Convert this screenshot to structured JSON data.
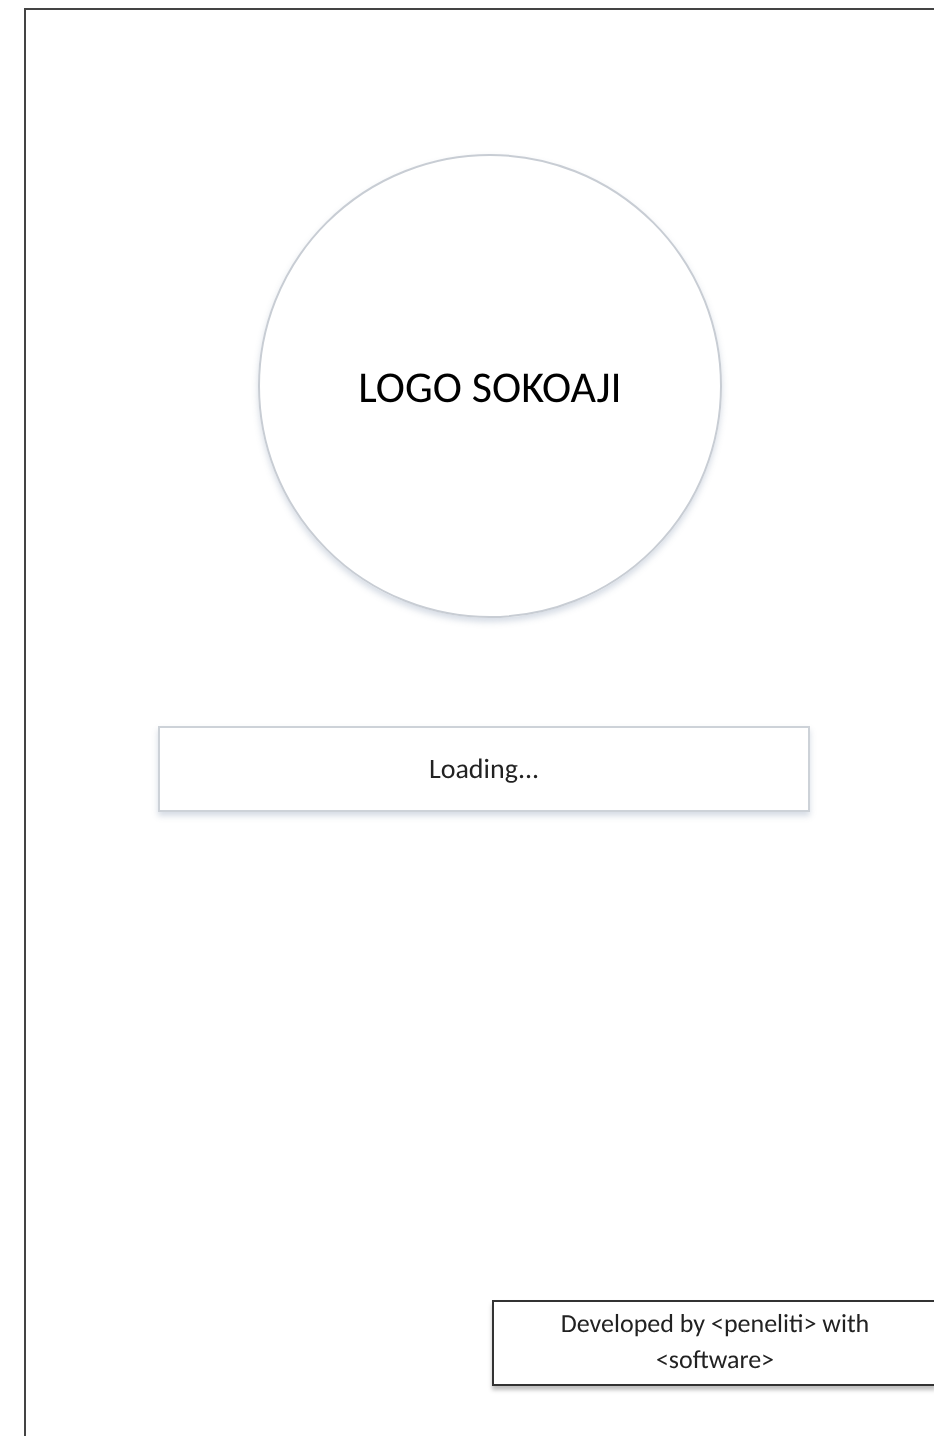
{
  "logo": {
    "text": "LOGO SOKOAJI"
  },
  "loading": {
    "text": "Loading..."
  },
  "footer": {
    "lines": [
      "Developed by <peneliti> with",
      "<software>"
    ]
  }
}
